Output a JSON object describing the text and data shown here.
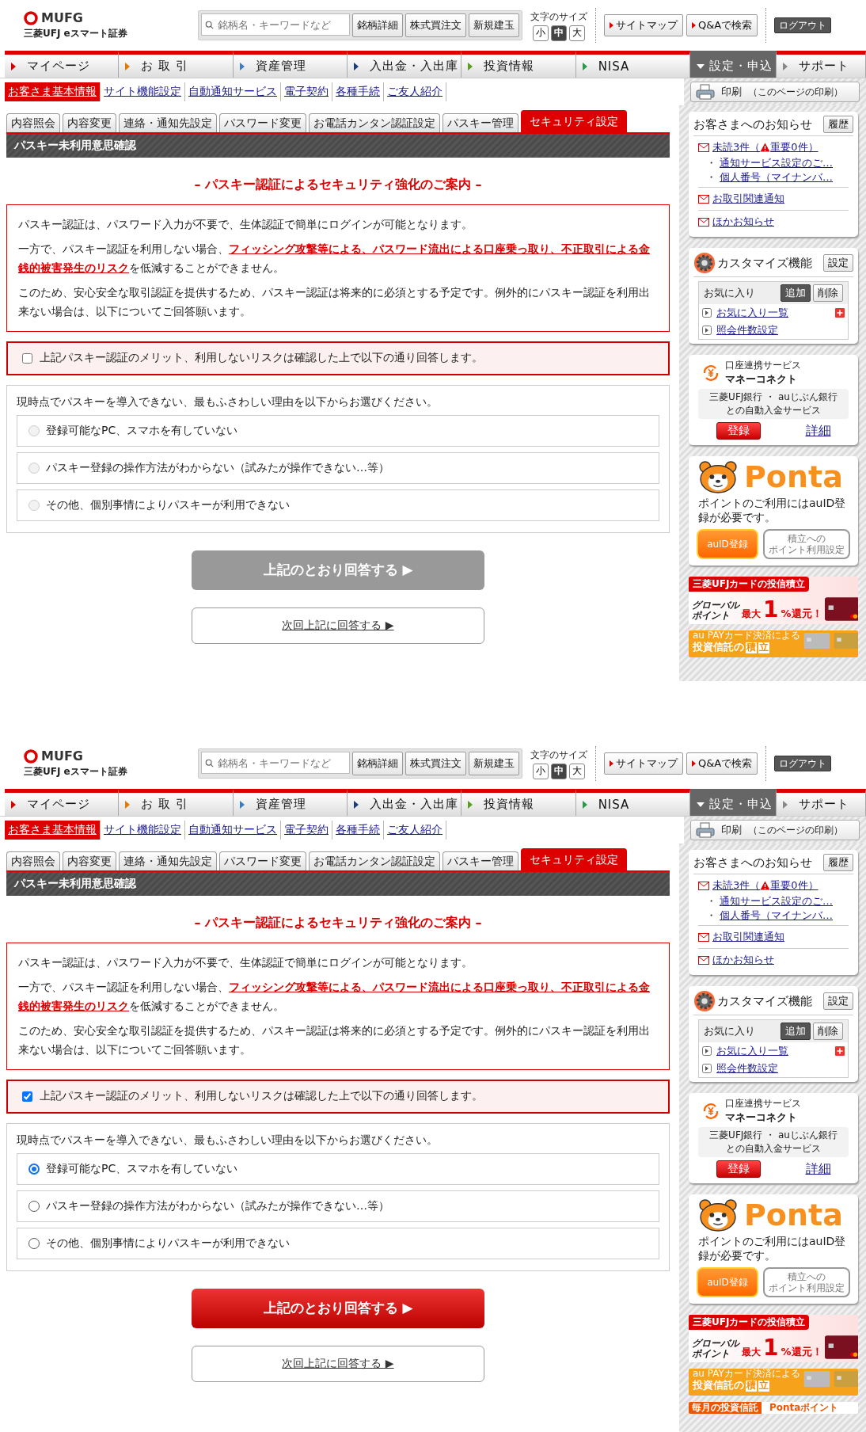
{
  "screens": [
    {
      "header": {
        "logo_brand": "MUFG",
        "logo_name": "三菱UFJ eスマート証券",
        "search_placeholder": "銘柄名・キーワードなど",
        "search_buttons": [
          "銘柄詳細",
          "株式買注文",
          "新規建玉"
        ],
        "font_size_label": "文字のサイズ",
        "font_sizes": [
          {
            "label": "小",
            "selected": false
          },
          {
            "label": "中",
            "selected": true
          },
          {
            "label": "大",
            "selected": false
          }
        ],
        "links": [
          "サイトマップ",
          "Q&Aで検索"
        ],
        "logout": "ログアウト"
      },
      "nav": [
        {
          "label": "マイページ",
          "color": "#d40000",
          "selected": false
        },
        {
          "label": "お 取 引",
          "color": "#e07a00",
          "selected": false
        },
        {
          "label": "資産管理",
          "color": "#3a7fc4",
          "selected": false
        },
        {
          "label": "入出金・入出庫",
          "color": "#1a3f7a",
          "selected": false
        },
        {
          "label": "投資情報",
          "color": "#5a9e1e",
          "selected": false
        },
        {
          "label": "NISA",
          "color": "#2a9a4a",
          "selected": false
        },
        {
          "label": "設定・申込",
          "color": "#ffffff",
          "selected": true
        },
        {
          "label": "サポート",
          "color": "#888888",
          "selected": false
        }
      ],
      "subnav": [
        {
          "label": "お客さま基本情報",
          "selected": true
        },
        {
          "label": "サイト機能設定",
          "selected": false
        },
        {
          "label": "自動通知サービス",
          "selected": false
        },
        {
          "label": "電子契約",
          "selected": false
        },
        {
          "label": "各種手続",
          "selected": false
        },
        {
          "label": "ご友人紹介",
          "selected": false
        }
      ],
      "print": {
        "label": "印刷",
        "note": "（このページの印刷）"
      },
      "tabs": [
        {
          "label": "内容照会",
          "selected": false
        },
        {
          "label": "内容変更",
          "selected": false
        },
        {
          "label": "連絡・通知先設定",
          "selected": false
        },
        {
          "label": "パスワード変更",
          "selected": false
        },
        {
          "label": "お電話カンタン認証設定",
          "selected": false
        },
        {
          "label": "パスキー管理",
          "selected": false
        },
        {
          "label": "セキュリティ設定",
          "selected": true
        }
      ],
      "page_title": "パスキー未利用意思確認",
      "heading": "– パスキー認証によるセキュリティ強化のご案内 –",
      "notice": [
        "パスキー認証は、パスワード入力が不要で、生体認証で簡単にログインが可能となります。",
        "一方で、パスキー認証を利用しない場合、**フィッシング攻撃等による、パスワード流出による口座乗っ取り、不正取引による金銭的被害発生のリスク**を低減することができません。",
        "このため、安心安全な取引認証を提供するため、パスキー認証は将来的に必須とする予定です。例外的にパスキー認証を利用出来ない場合は、以下についてご回答願います。"
      ],
      "confirm": {
        "label": "上記パスキー認証のメリット、利用しないリスクは確認した上で以下の通り回答します。",
        "checked": false
      },
      "question": "現時点でパスキーを導入できない、最もふさわしい理由を以下からお選びください。",
      "options": [
        {
          "label": "登録可能なPC、スマホを有していない",
          "selected": false,
          "disabled": true
        },
        {
          "label": "パスキー登録の操作方法がわからない（試みたが操作できない…等）",
          "selected": false,
          "disabled": true
        },
        {
          "label": "その他、個別事情によりパスキーが利用できない",
          "selected": false,
          "disabled": true
        }
      ],
      "submit": {
        "label": "上記のとおり回答する ▶",
        "disabled": true
      },
      "later": "次回上記に回答する ▶",
      "sidebar": {
        "notices": {
          "title": "お客さまへのお知らせ",
          "history": "履歴",
          "unread": "未読3件（",
          "important": "重要0件）",
          "sub_items": [
            {
              "bullet": "・",
              "label": "通知サービス設定のご…"
            },
            {
              "bullet": "・",
              "label": "個人番号（マイナンバ…"
            }
          ],
          "links": [
            "お取引関連通知",
            "ほかお知らせ"
          ]
        },
        "customize": {
          "title": "カスタマイズ機能",
          "settings": "設定",
          "favorites": "お気に入り",
          "add": "追加",
          "remove": "削除",
          "links": [
            "お気に入り一覧",
            "照会件数設定"
          ]
        },
        "money": {
          "service": "口座連携サービス",
          "name": "マネーコネクト",
          "description": [
            "三菱UFJ銀行 ・ auじぶん銀行",
            "との自動入金サービス"
          ],
          "register": "登録",
          "details": "詳細"
        },
        "ponta": {
          "logo": "Ponta",
          "text": "ポイントのご利用にはauID登録が必要です。",
          "register": "auID登録",
          "settings": [
            "積立への",
            "ポイント利用設定"
          ]
        },
        "banners": [
          {
            "kind": "card",
            "lines": [
              "三菱UFJカードの投信積立",
              "グローバル",
              "ポイント",
              "最大",
              "1",
              "%還元！"
            ]
          },
          {
            "kind": "aupay",
            "lines": [
              "au PAYカード決済による",
              "投資信託の",
              "積",
              "立"
            ]
          }
        ]
      }
    },
    {
      "header": {
        "logo_brand": "MUFG",
        "logo_name": "三菱UFJ eスマート証券",
        "search_placeholder": "銘柄名・キーワードなど",
        "search_buttons": [
          "銘柄詳細",
          "株式買注文",
          "新規建玉"
        ],
        "font_size_label": "文字のサイズ",
        "font_sizes": [
          {
            "label": "小",
            "selected": false
          },
          {
            "label": "中",
            "selected": true
          },
          {
            "label": "大",
            "selected": false
          }
        ],
        "links": [
          "サイトマップ",
          "Q&Aで検索"
        ],
        "logout": "ログアウト"
      },
      "nav": [
        {
          "label": "マイページ",
          "color": "#d40000",
          "selected": false
        },
        {
          "label": "お 取 引",
          "color": "#e07a00",
          "selected": false
        },
        {
          "label": "資産管理",
          "color": "#3a7fc4",
          "selected": false
        },
        {
          "label": "入出金・入出庫",
          "color": "#1a3f7a",
          "selected": false
        },
        {
          "label": "投資情報",
          "color": "#5a9e1e",
          "selected": false
        },
        {
          "label": "NISA",
          "color": "#2a9a4a",
          "selected": false
        },
        {
          "label": "設定・申込",
          "color": "#ffffff",
          "selected": true
        },
        {
          "label": "サポート",
          "color": "#888888",
          "selected": false
        }
      ],
      "subnav": [
        {
          "label": "お客さま基本情報",
          "selected": true
        },
        {
          "label": "サイト機能設定",
          "selected": false
        },
        {
          "label": "自動通知サービス",
          "selected": false
        },
        {
          "label": "電子契約",
          "selected": false
        },
        {
          "label": "各種手続",
          "selected": false
        },
        {
          "label": "ご友人紹介",
          "selected": false
        }
      ],
      "print": {
        "label": "印刷",
        "note": "（このページの印刷）"
      },
      "tabs": [
        {
          "label": "内容照会",
          "selected": false
        },
        {
          "label": "内容変更",
          "selected": false
        },
        {
          "label": "連絡・通知先設定",
          "selected": false
        },
        {
          "label": "パスワード変更",
          "selected": false
        },
        {
          "label": "お電話カンタン認証設定",
          "selected": false
        },
        {
          "label": "パスキー管理",
          "selected": false
        },
        {
          "label": "セキュリティ設定",
          "selected": true
        }
      ],
      "page_title": "パスキー未利用意思確認",
      "heading": "– パスキー認証によるセキュリティ強化のご案内 –",
      "notice": [
        "パスキー認証は、パスワード入力が不要で、生体認証で簡単にログインが可能となります。",
        "一方で、パスキー認証を利用しない場合、**フィッシング攻撃等による、パスワード流出による口座乗っ取り、不正取引による金銭的被害発生のリスク**を低減することができません。",
        "このため、安心安全な取引認証を提供するため、パスキー認証は将来的に必須とする予定です。例外的にパスキー認証を利用出来ない場合は、以下についてご回答願います。"
      ],
      "confirm": {
        "label": "上記パスキー認証のメリット、利用しないリスクは確認した上で以下の通り回答します。",
        "checked": true
      },
      "question": "現時点でパスキーを導入できない、最もふさわしい理由を以下からお選びください。",
      "options": [
        {
          "label": "登録可能なPC、スマホを有していない",
          "selected": true,
          "disabled": false
        },
        {
          "label": "パスキー登録の操作方法がわからない（試みたが操作できない…等）",
          "selected": false,
          "disabled": false
        },
        {
          "label": "その他、個別事情によりパスキーが利用できない",
          "selected": false,
          "disabled": false
        }
      ],
      "submit": {
        "label": "上記のとおり回答する ▶",
        "disabled": false
      },
      "later": "次回上記に回答する ▶",
      "sidebar": {
        "notices": {
          "title": "お客さまへのお知らせ",
          "history": "履歴",
          "unread": "未読3件（",
          "important": "重要0件）",
          "sub_items": [
            {
              "bullet": "・",
              "label": "通知サービス設定のご…"
            },
            {
              "bullet": "・",
              "label": "個人番号（マイナンバ…"
            }
          ],
          "links": [
            "お取引関連通知",
            "ほかお知らせ"
          ]
        },
        "customize": {
          "title": "カスタマイズ機能",
          "settings": "設定",
          "favorites": "お気に入り",
          "add": "追加",
          "remove": "削除",
          "links": [
            "お気に入り一覧",
            "照会件数設定"
          ]
        },
        "money": {
          "service": "口座連携サービス",
          "name": "マネーコネクト",
          "description": [
            "三菱UFJ銀行 ・ auじぶん銀行",
            "との自動入金サービス"
          ],
          "register": "登録",
          "details": "詳細"
        },
        "ponta": {
          "logo": "Ponta",
          "text": "ポイントのご利用にはauID登録が必要です。",
          "register": "auID登録",
          "settings": [
            "積立への",
            "ポイント利用設定"
          ]
        },
        "banners": [
          {
            "kind": "card",
            "lines": [
              "三菱UFJカードの投信積立",
              "グローバル",
              "ポイント",
              "最大",
              "1",
              "%還元！"
            ]
          },
          {
            "kind": "aupay",
            "lines": [
              "au PAYカード決済による",
              "投資信託の",
              "積",
              "立"
            ]
          },
          {
            "kind": "ponta",
            "lines": [
              "毎月の投資信託",
              "Pontaポイント"
            ]
          }
        ]
      }
    }
  ]
}
